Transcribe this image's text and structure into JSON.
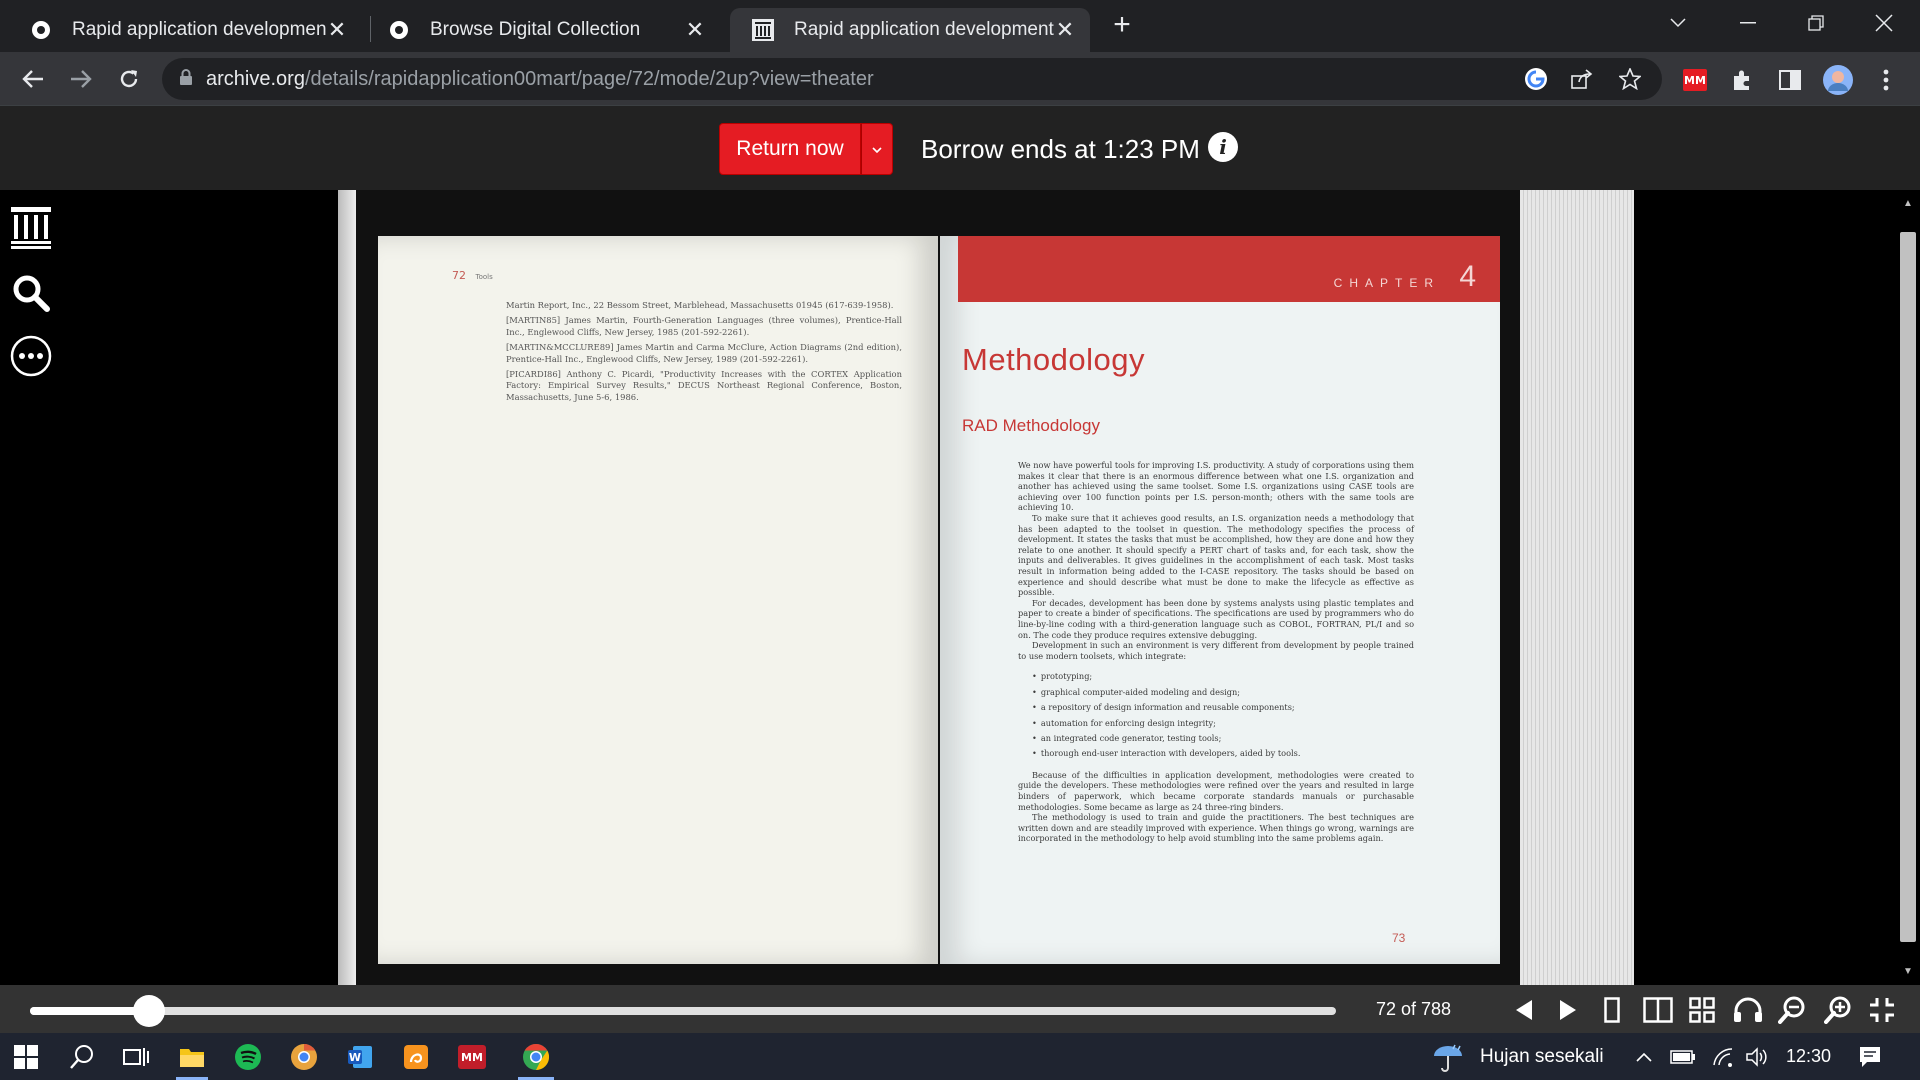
{
  "browser": {
    "tabs": [
      {
        "title": "Rapid application development: |",
        "favicon": "ia-gear-icon",
        "active": false
      },
      {
        "title": "Browse Digital Collection",
        "favicon": "ia-gear-icon",
        "active": false
      },
      {
        "title": "Rapid application development :",
        "favicon": "archive-building-icon",
        "active": true
      }
    ],
    "new_tab": "+",
    "url": {
      "host": "archive.org",
      "path": "/details/rapidapplication00mart/page/72/mode/2up?view=theater"
    }
  },
  "borrow": {
    "return_label": "Return now",
    "expiry_text": "Borrow ends at 1:23 PM",
    "info_glyph": "i"
  },
  "book": {
    "left_page": {
      "folio": "72",
      "section": "Tools",
      "references": [
        "Martin Report, Inc., 22 Bessom Street, Marblehead, Massachusetts 01945 (617-639-1958).",
        "[MARTIN85] James Martin, Fourth-Generation Languages (three volumes), Prentice-Hall Inc., Englewood Cliffs, New Jersey, 1985 (201-592-2261).",
        "[MARTIN&MCCLURE89] James Martin and Carma McClure, Action Diagrams (2nd edition), Prentice-Hall Inc., Englewood Cliffs, New Jersey, 1989 (201-592-2261).",
        "[PICARDI86] Anthony C. Picardi, \"Productivity Increases with the CORTEX Application Factory: Empirical Survey Results,\" DECUS Northeast Regional Conference, Boston, Massachusetts, June 5-6, 1986."
      ]
    },
    "right_page": {
      "chapter_label": "CHAPTER",
      "chapter_number": "4",
      "title": "Methodology",
      "section_heading": "RAD Methodology",
      "paragraphs_1": [
        "We now have powerful tools for improving I.S. productivity. A study of corporations using them makes it clear that there is an enormous difference between what one I.S. organization and another has achieved using the same toolset. Some I.S. organizations using CASE tools are achieving over 100 function points per I.S. person-month; others with the same tools are achieving 10.",
        "To make sure that it achieves good results, an I.S. organization needs a methodology that has been adapted to the toolset in question. The methodology specifies the process of development. It states the tasks that must be accomplished, how they are done and how they relate to one another. It should specify a PERT chart of tasks and, for each task, show the inputs and deliverables. It gives guidelines in the accomplishment of each task. Most tasks result in information being added to the I-CASE repository. The tasks should be based on experience and should describe what must be done to make the lifecycle as effective as possible.",
        "For decades, development has been done by systems analysts using plastic templates and paper to create a binder of specifications. The specifications are used by programmers who do line-by-line coding with a third-generation language such as COBOL, FORTRAN, PL/I and so on. The code they produce requires extensive debugging.",
        "Development in such an environment is very different from development by people trained to use modern toolsets, which integrate:"
      ],
      "bullets": [
        "prototyping;",
        "graphical computer-aided modeling and design;",
        "a repository of design information and reusable components;",
        "automation for enforcing design integrity;",
        "an integrated code generator, testing tools;",
        "thorough end-user interaction with developers, aided by tools."
      ],
      "paragraphs_2": [
        "Because of the difficulties in application development, methodologies were created to guide the developers. These methodologies were refined over the years and resulted in large binders of paperwork, which became corporate standards manuals or purchasable methodologies. Some became as large as 24 three-ring binders.",
        "The methodology is used to train and guide the practitioners. The best techniques are written down and are steadily improved with experience. When things go wrong, warnings are incorporated in the methodology to help avoid stumbling into the same problems again."
      ],
      "folio": "73"
    }
  },
  "navigation": {
    "page_counter": "72 of 788",
    "progress_fraction": 0.0914
  },
  "taskbar": {
    "weather": "Hujan sesekali",
    "time": "12:30"
  }
}
